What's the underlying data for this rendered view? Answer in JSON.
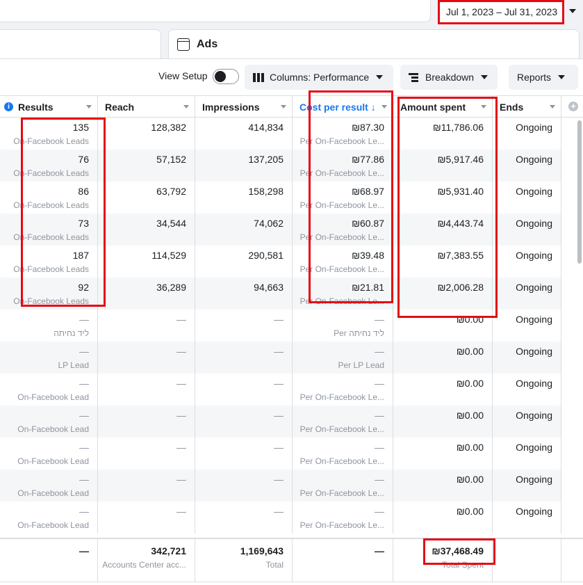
{
  "date_range": {
    "label": "Jul 1, 2023 – Jul 31, 2023"
  },
  "tabs": {
    "ads_label": "Ads"
  },
  "toolbar": {
    "view_setup": "View Setup",
    "columns": "Columns: Performance",
    "breakdown": "Breakdown",
    "reports": "Reports"
  },
  "columns": [
    "Results",
    "Reach",
    "Impressions",
    "Cost per result ↓",
    "Amount spent",
    "Ends"
  ],
  "rows": [
    {
      "results": "135",
      "results_sub": "On-Facebook Leads",
      "reach": "128,382",
      "impressions": "414,834",
      "cpr": "₪87.30",
      "cpr_sub": "Per On-Facebook Le...",
      "spent": "₪11,786.06",
      "ends": "Ongoing"
    },
    {
      "results": "76",
      "results_sub": "On-Facebook Leads",
      "reach": "57,152",
      "impressions": "137,205",
      "cpr": "₪77.86",
      "cpr_sub": "Per On-Facebook Le...",
      "spent": "₪5,917.46",
      "ends": "Ongoing"
    },
    {
      "results": "86",
      "results_sub": "On-Facebook Leads",
      "reach": "63,792",
      "impressions": "158,298",
      "cpr": "₪68.97",
      "cpr_sub": "Per On-Facebook Le...",
      "spent": "₪5,931.40",
      "ends": "Ongoing"
    },
    {
      "results": "73",
      "results_sub": "On-Facebook Leads",
      "reach": "34,544",
      "impressions": "74,062",
      "cpr": "₪60.87",
      "cpr_sub": "Per On-Facebook Le...",
      "spent": "₪4,443.74",
      "ends": "Ongoing"
    },
    {
      "results": "187",
      "results_sub": "On-Facebook Leads",
      "reach": "114,529",
      "impressions": "290,581",
      "cpr": "₪39.48",
      "cpr_sub": "Per On-Facebook Le...",
      "spent": "₪7,383.55",
      "ends": "Ongoing"
    },
    {
      "results": "92",
      "results_sub": "On-Facebook Leads",
      "reach": "36,289",
      "impressions": "94,663",
      "cpr": "₪21.81",
      "cpr_sub": "Per On-Facebook Le...",
      "spent": "₪2,006.28",
      "ends": "Ongoing"
    },
    {
      "results": "—",
      "results_sub": "ליד נחיתה",
      "reach": "—",
      "impressions": "—",
      "cpr": "—",
      "cpr_sub": "Per ליד נחיתה",
      "spent": "₪0.00",
      "ends": "Ongoing"
    },
    {
      "results": "—",
      "results_sub": "LP Lead",
      "reach": "—",
      "impressions": "—",
      "cpr": "—",
      "cpr_sub": "Per LP Lead",
      "spent": "₪0.00",
      "ends": "Ongoing"
    },
    {
      "results": "—",
      "results_sub": "On-Facebook Lead",
      "reach": "—",
      "impressions": "—",
      "cpr": "—",
      "cpr_sub": "Per On-Facebook Le...",
      "spent": "₪0.00",
      "ends": "Ongoing"
    },
    {
      "results": "—",
      "results_sub": "On-Facebook Lead",
      "reach": "—",
      "impressions": "—",
      "cpr": "—",
      "cpr_sub": "Per On-Facebook Le...",
      "spent": "₪0.00",
      "ends": "Ongoing"
    },
    {
      "results": "—",
      "results_sub": "On-Facebook Lead",
      "reach": "—",
      "impressions": "—",
      "cpr": "—",
      "cpr_sub": "Per On-Facebook Le...",
      "spent": "₪0.00",
      "ends": "Ongoing"
    },
    {
      "results": "—",
      "results_sub": "On-Facebook Lead",
      "reach": "—",
      "impressions": "—",
      "cpr": "—",
      "cpr_sub": "Per On-Facebook Le...",
      "spent": "₪0.00",
      "ends": "Ongoing"
    },
    {
      "results": "—",
      "results_sub": "On-Facebook Lead",
      "reach": "—",
      "impressions": "—",
      "cpr": "—",
      "cpr_sub": "Per On-Facebook Le...",
      "spent": "₪0.00",
      "ends": "Ongoing"
    }
  ],
  "totals": {
    "results": "—",
    "reach": "342,721",
    "reach_sub": "Accounts Center acc...",
    "impressions": "1,169,643",
    "impressions_sub": "Total",
    "cpr": "—",
    "spent": "₪37,468.49",
    "spent_sub": "Total Spent"
  },
  "colors": {
    "accent": "#1877f2",
    "highlight": "#e50914"
  }
}
